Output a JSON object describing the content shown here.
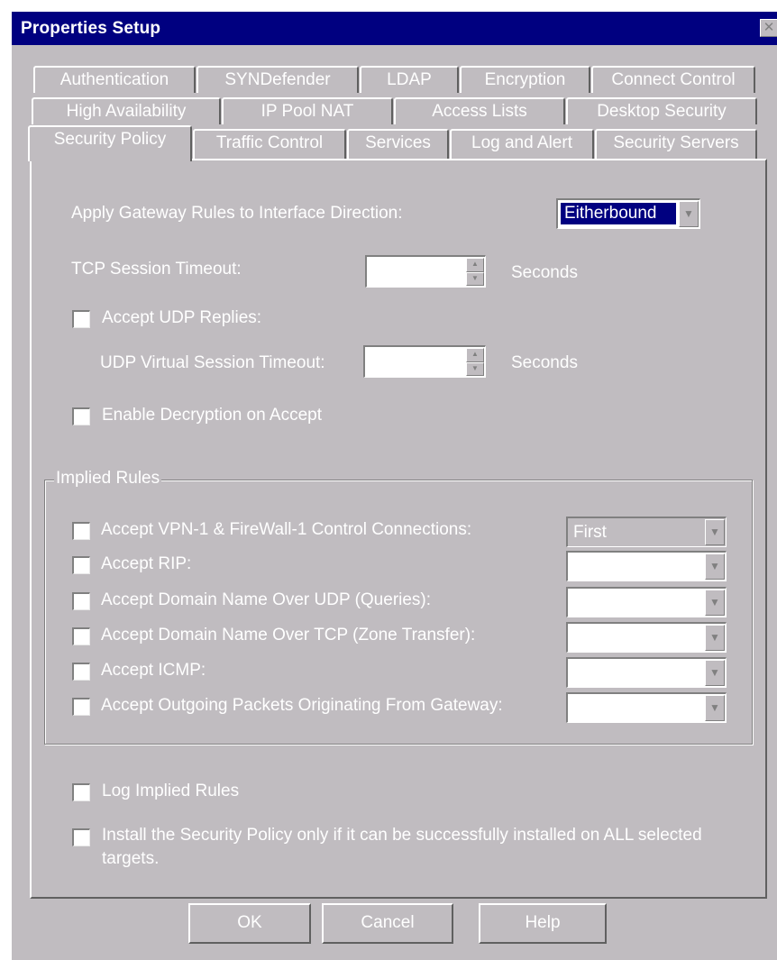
{
  "window": {
    "title": "Properties Setup",
    "close_glyph": "✕"
  },
  "tabs": {
    "row1": [
      "Authentication",
      "SYNDefender",
      "LDAP",
      "Encryption",
      "Connect Control"
    ],
    "row2": [
      "High Availability",
      "IP Pool NAT",
      "Access Lists",
      "Desktop Security"
    ],
    "row3": [
      "Security Policy",
      "Traffic Control",
      "Services",
      "Log and Alert",
      "Security Servers"
    ],
    "active": "Security Policy"
  },
  "security_policy": {
    "apply_rules_label": "Apply Gateway Rules to Interface Direction:",
    "apply_rules_value": "Eitherbound",
    "tcp_timeout_label": "TCP Session Timeout:",
    "tcp_timeout_value": "",
    "tcp_timeout_unit": "Seconds",
    "accept_udp_label": "Accept UDP Replies:",
    "udp_timeout_label": "UDP Virtual Session Timeout:",
    "udp_timeout_value": "",
    "udp_timeout_unit": "Seconds",
    "enable_decryption_label": "Enable Decryption on Accept"
  },
  "implied_rules": {
    "legend": "Implied Rules",
    "rules": [
      {
        "label": "Accept VPN-1 & FireWall-1 Control Connections:",
        "value": "First"
      },
      {
        "label": "Accept RIP:",
        "value": ""
      },
      {
        "label": "Accept Domain Name Over UDP (Queries):",
        "value": ""
      },
      {
        "label": "Accept Domain Name Over TCP (Zone Transfer):",
        "value": ""
      },
      {
        "label": "Accept ICMP:",
        "value": ""
      },
      {
        "label": "Accept Outgoing Packets Originating From Gateway:",
        "value": ""
      }
    ]
  },
  "log_implied_label": "Log Implied Rules",
  "install_policy_label": "Install the Security Policy only if it can be successfully installed on ALL selected targets.",
  "buttons": {
    "ok": "OK",
    "cancel": "Cancel",
    "help": "Help"
  },
  "colors": {
    "face": "#c0bcc0",
    "title_bar": "#000080",
    "selection": "#000080"
  }
}
